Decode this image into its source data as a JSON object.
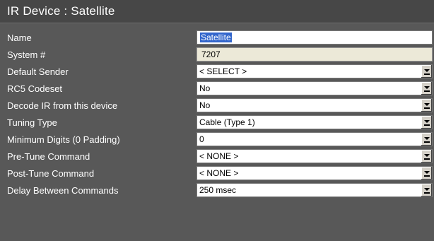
{
  "title": "IR Device : Satellite",
  "colors": {
    "background": "#585858",
    "title_bar": "#474747",
    "selection": "#3366cc",
    "readonly_field": "#ece9d8"
  },
  "fields": {
    "name": {
      "label": "Name",
      "value": "Satellite"
    },
    "system_number": {
      "label": "System #",
      "value": "7207"
    },
    "default_sender": {
      "label": "Default Sender",
      "value": "< SELECT >"
    },
    "rc5_codeset": {
      "label": "RC5 Codeset",
      "value": "No"
    },
    "decode_ir": {
      "label": "Decode IR from this device",
      "value": "No"
    },
    "tuning_type": {
      "label": "Tuning Type",
      "value": "Cable (Type 1)"
    },
    "minimum_digits": {
      "label": "Minimum Digits (0 Padding)",
      "value": "0"
    },
    "pre_tune_command": {
      "label": "Pre-Tune Command",
      "value": "< NONE >"
    },
    "post_tune_command": {
      "label": "Post-Tune Command",
      "value": "< NONE >"
    },
    "delay_between_commands": {
      "label": "Delay Between Commands",
      "value": "250 msec"
    }
  },
  "icons": {
    "dropdown": "chevron-down-icon"
  }
}
